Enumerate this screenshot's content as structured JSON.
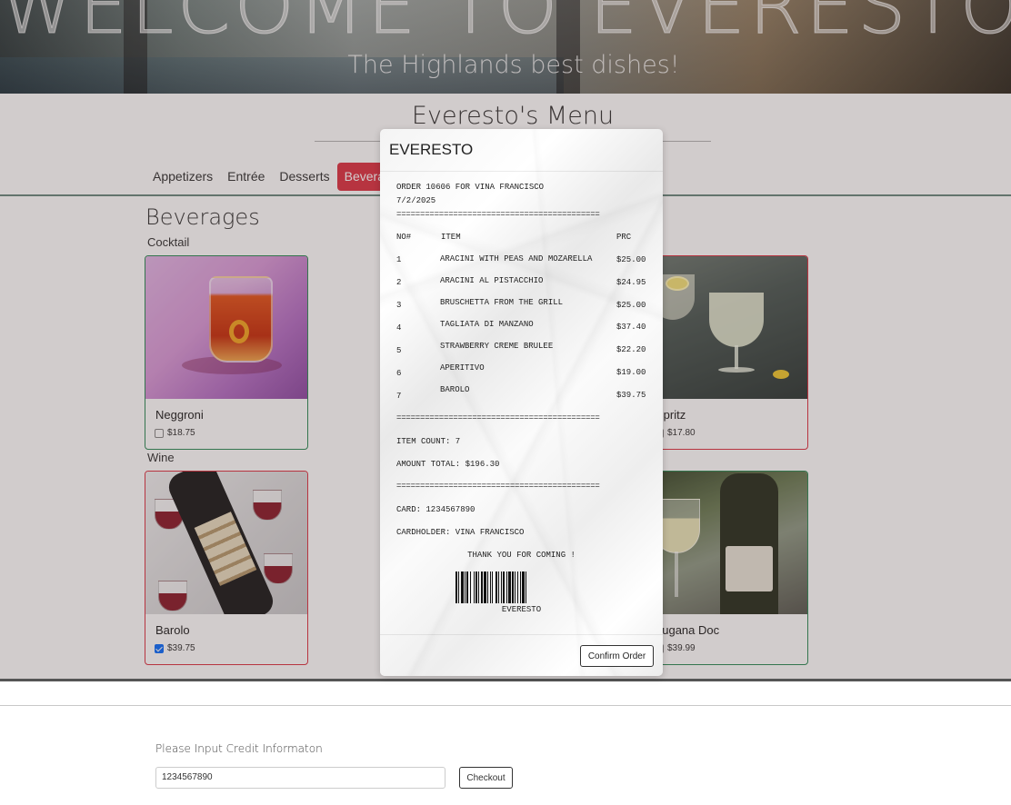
{
  "hero": {
    "title": "WELCOME TO EVERESTO",
    "subtitle": "The Highlands best dishes!"
  },
  "menu": {
    "title": "Everesto's Menu",
    "tabs": [
      {
        "label": "Appetizers",
        "active": false
      },
      {
        "label": "Entrée",
        "active": false
      },
      {
        "label": "Desserts",
        "active": false
      },
      {
        "label": "Beverages",
        "active": true
      }
    ],
    "section_title": "Beverages",
    "categories": [
      {
        "label": "Cocktail",
        "items": [
          {
            "name": "Neggroni",
            "price": "$18.75",
            "checked": false,
            "border": "green"
          },
          {
            "name": "Spritz",
            "price": "$17.80",
            "checked": false,
            "border": "red"
          }
        ]
      },
      {
        "label": "Wine",
        "items": [
          {
            "name": "Barolo",
            "price": "$39.75",
            "checked": true,
            "border": "red"
          },
          {
            "name": "Lugana Doc",
            "price": "$39.99",
            "checked": false,
            "border": "green"
          }
        ]
      }
    ],
    "colors": {
      "active_tab": "#dc3545",
      "green_border": "#2e8b57",
      "red_border": "#dc3545"
    }
  },
  "receipt": {
    "header": "EVERESTO",
    "order_line": "ORDER 10606 FOR VINA FRANCISCO",
    "date": "7/2/2025",
    "separator": "===========================================",
    "columns": {
      "no": "NO#",
      "item": "ITEM",
      "price": "PRC"
    },
    "items": [
      {
        "no": "1",
        "name": "ARACINI WITH PEAS AND MOZARELLA",
        "price": "$25.00"
      },
      {
        "no": "2",
        "name": "ARACINI AL PISTACCHIO",
        "price": "$24.95"
      },
      {
        "no": "3",
        "name": "BRUSCHETTA FROM THE GRILL",
        "price": "$25.00"
      },
      {
        "no": "4",
        "name": "TAGLIATA DI MANZANO",
        "price": "$37.40"
      },
      {
        "no": "5",
        "name": "STRAWBERRY CREME BRULEE",
        "price": "$22.20"
      },
      {
        "no": "6",
        "name": "APERITIVO",
        "price": "$19.00"
      },
      {
        "no": "7",
        "name": "BAROLO",
        "price": "$39.75"
      }
    ],
    "item_count": "ITEM COUNT: 7",
    "amount_total": "AMOUNT TOTAL: $196.30",
    "card": "CARD: 1234567890",
    "cardholder": "CARDHOLDER: VINA FRANCISCO",
    "thanks": "THANK YOU FOR COMING !",
    "barcode_text": "EVERESTO",
    "confirm_label": "Confirm Order"
  },
  "checkout": {
    "label": "Please Input Credit Informaton",
    "card_value": "1234567890",
    "button_label": "Checkout"
  }
}
